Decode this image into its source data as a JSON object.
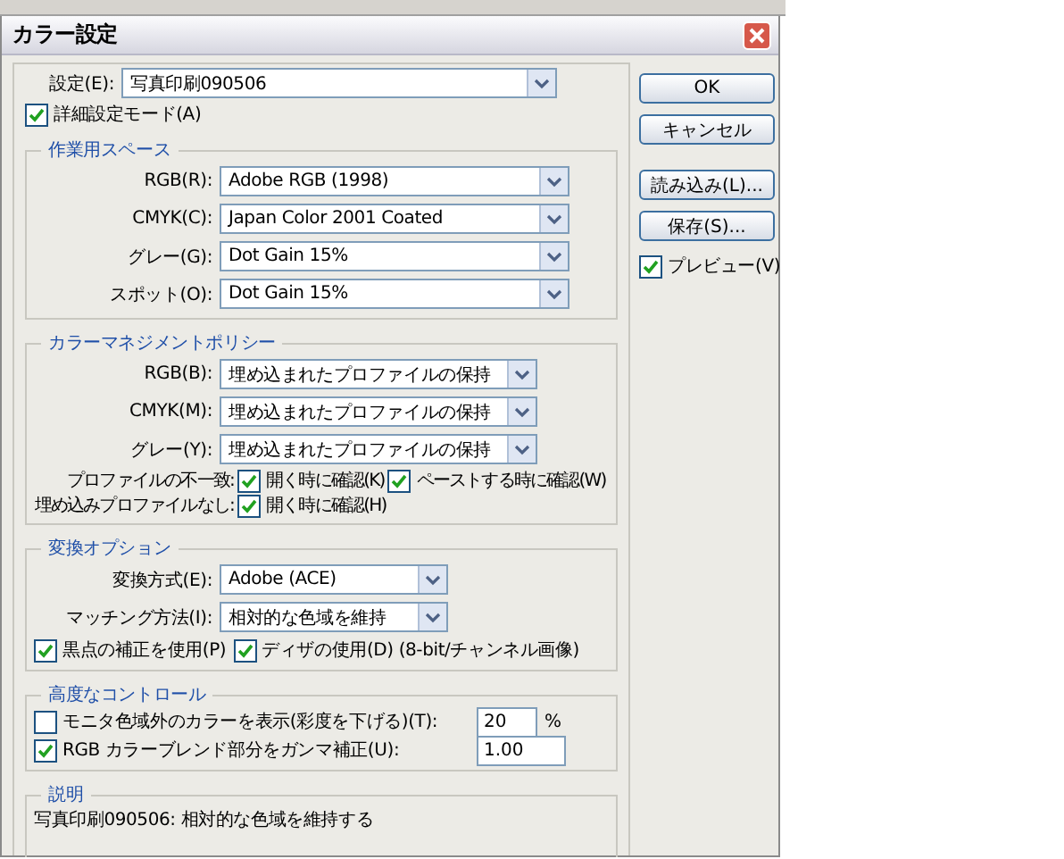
{
  "window": {
    "title": "カラー設定"
  },
  "settings": {
    "label": "設定(E):",
    "value": "写真印刷090506"
  },
  "advanced_mode": {
    "label": "詳細設定モード(A)",
    "checked": true
  },
  "working_spaces": {
    "title": "作業用スペース",
    "rows": [
      {
        "label": "RGB(R):",
        "value": "Adobe RGB (1998)"
      },
      {
        "label": "CMYK(C):",
        "value": "Japan Color 2001 Coated"
      },
      {
        "label": "グレー(G):",
        "value": "Dot Gain 15%"
      },
      {
        "label": "スポット(O):",
        "value": "Dot Gain 15%"
      }
    ]
  },
  "policies": {
    "title": "カラーマネジメントポリシー",
    "rows": [
      {
        "label": "RGB(B):",
        "value": "埋め込まれたプロファイルの保持"
      },
      {
        "label": "CMYK(M):",
        "value": "埋め込まれたプロファイルの保持"
      },
      {
        "label": "グレー(Y):",
        "value": "埋め込まれたプロファイルの保持"
      }
    ],
    "checks": [
      {
        "label": "プロファイルの不一致:",
        "options": [
          {
            "label": "開く時に確認(K)",
            "checked": true
          },
          {
            "label": "ペーストする時に確認(W)",
            "checked": true
          }
        ]
      },
      {
        "label": "埋め込みプロファイルなし:",
        "options": [
          {
            "label": "開く時に確認(H)",
            "checked": true
          }
        ]
      }
    ]
  },
  "conversion": {
    "title": "変換オプション",
    "rows": [
      {
        "label": "変換方式(E):",
        "value": "Adobe (ACE)"
      },
      {
        "label": "マッチング方法(I):",
        "value": "相対的な色域を維持"
      }
    ],
    "options": [
      {
        "label": "黒点の補正を使用(P)",
        "checked": true
      },
      {
        "label": "ディザの使用(D) (8-bit/チャンネル画像)",
        "checked": true
      }
    ]
  },
  "advanced": {
    "title": "高度なコントロール",
    "rows": [
      {
        "label": "モニタ色域外のカラーを表示(彩度を下げる)(T):",
        "checked": false,
        "value": "20",
        "unit": "%"
      },
      {
        "label": "RGB カラーブレンド部分をガンマ補正(U):",
        "checked": true,
        "value": "1.00"
      }
    ]
  },
  "description": {
    "title": "説明",
    "text": "写真印刷090506: 相対的な色域を維持する"
  },
  "buttons": [
    {
      "label": "OK"
    },
    {
      "label": "キャンセル"
    },
    {
      "label": "読み込み(L)..."
    },
    {
      "label": "保存(S)..."
    }
  ],
  "preview": {
    "label": "プレビュー(V)",
    "checked": true
  }
}
